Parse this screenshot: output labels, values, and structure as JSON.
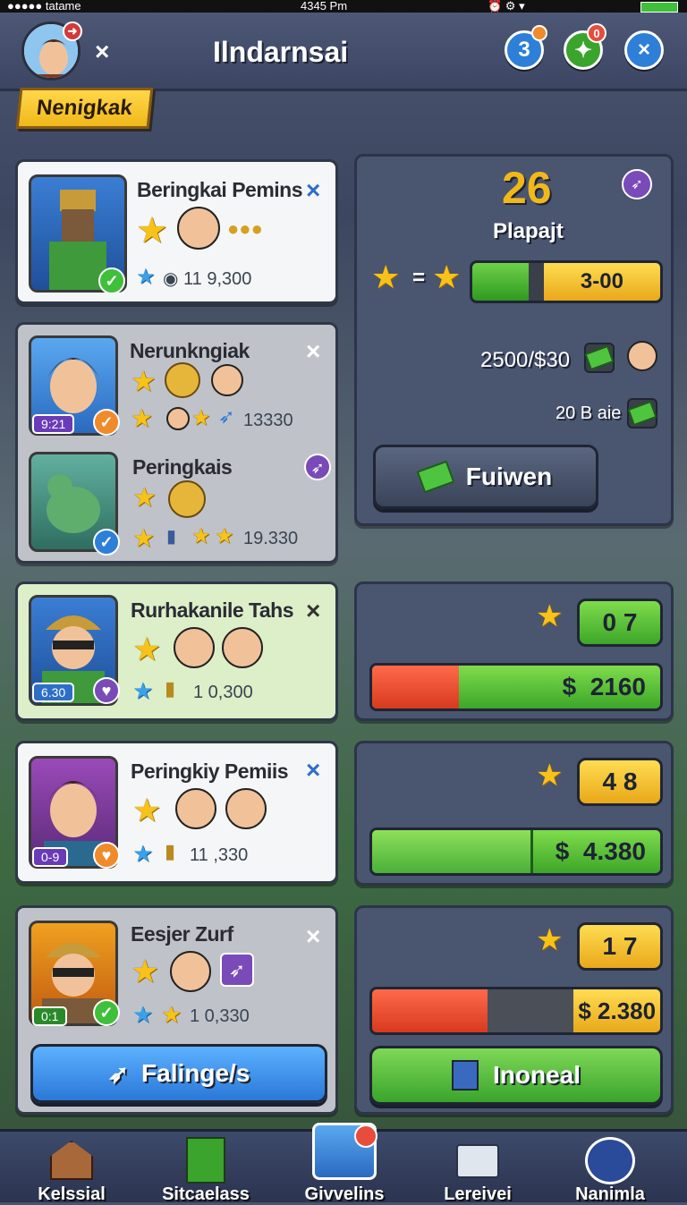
{
  "status_bar": {
    "carrier": "●●●●● tatame",
    "time": "4345 Pm",
    "icons": [
      "alarm-icon",
      "wifi-icon",
      "battery-icon"
    ]
  },
  "header": {
    "title": "Ilndarnsai",
    "close": "×",
    "badge_left": "3",
    "badge_left_dot": "",
    "badge_right": "0",
    "close_icon": "×"
  },
  "section_tag": "Nenigkak",
  "cards": [
    {
      "name": "Beringkai Pemins",
      "stat": "11 9,300",
      "level": ""
    },
    {
      "name": "Nerunkngiak",
      "stat": "13330",
      "level": "9:21"
    },
    {
      "name": "Peringkais",
      "stat": "19.330",
      "level": ""
    },
    {
      "name": "Rurhakanile Tahs",
      "stat": "1 0,300",
      "level": "6.30"
    },
    {
      "name": "Peringkiy Pemiis",
      "stat": "11 ,330",
      "level": "0-9"
    },
    {
      "name": "Eesjer Zurf",
      "stat": "1 0,330",
      "level": "0:1"
    }
  ],
  "left_button": "Falinge/s",
  "right_panel": {
    "top_number": "26",
    "player_label": "Plapajt",
    "equals": "=",
    "progress_value": "3-00",
    "progress_fraction": 0.3,
    "price_line": "2500/$30",
    "stock_line": "20 B aie",
    "button": "Fuiwen"
  },
  "reward_panels": [
    {
      "count": "0 7",
      "price": "$  2160",
      "fill_fraction": 0.3
    },
    {
      "count": "4 8",
      "price": "$  4.380",
      "fill_fraction": 0.55
    },
    {
      "count": "1 7",
      "price": "$  2.380",
      "fill_fraction": 0.4
    }
  ],
  "right_button": "Inoneal",
  "bottom_nav": [
    {
      "label": "Kelssial",
      "icon": "house-icon"
    },
    {
      "label": "Sitcaelass",
      "icon": "door-icon"
    },
    {
      "label": "Givvelins",
      "icon": "hero-portrait-icon"
    },
    {
      "label": "Lereivei",
      "icon": "key-card-icon"
    },
    {
      "label": "Nanimla",
      "icon": "profile-icon"
    }
  ],
  "colors": {
    "accent_gold": "#f0b81a",
    "accent_green": "#3da629",
    "accent_blue": "#2a78d8",
    "accent_red": "#e74c3c"
  }
}
